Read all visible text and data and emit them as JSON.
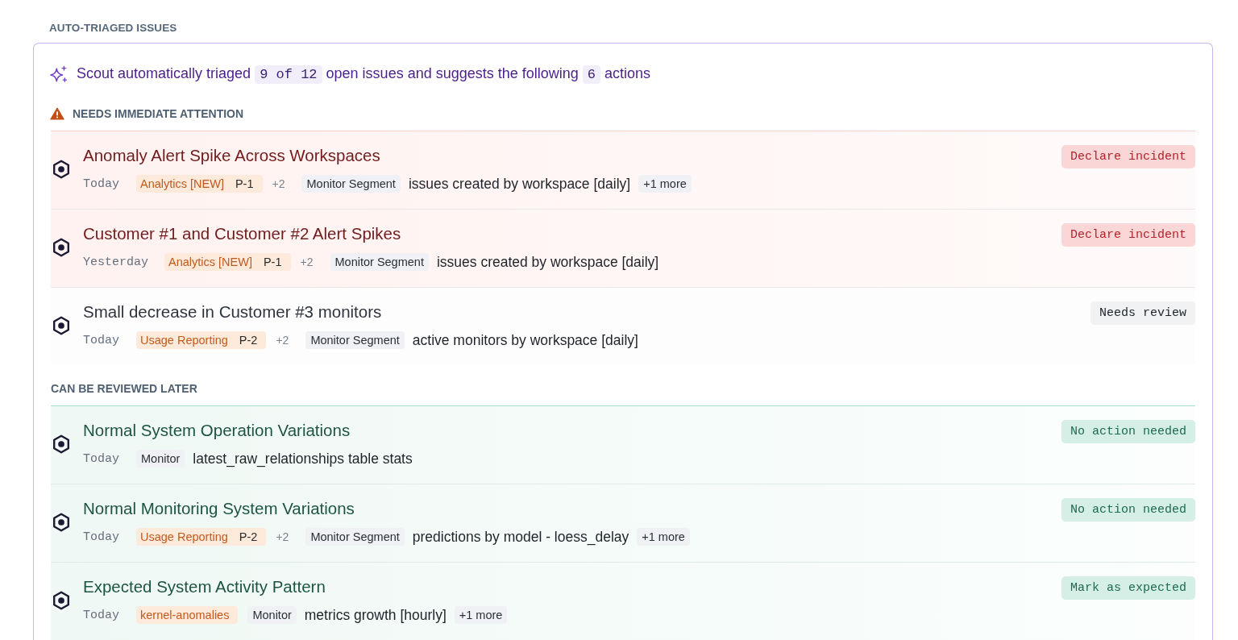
{
  "header": {
    "title": "AUTO-TRIAGED ISSUES"
  },
  "summary": {
    "parts": [
      {
        "kind": "text",
        "text": "Scout automatically triaged"
      },
      {
        "kind": "code",
        "text": "9 of 12"
      },
      {
        "kind": "text",
        "text": "open issues and suggests the following"
      },
      {
        "kind": "code",
        "text": "6"
      },
      {
        "kind": "text",
        "text": "actions"
      }
    ]
  },
  "groups": [
    {
      "kind": "urgent",
      "title": "NEEDS IMMEDIATE ATTENTION",
      "issues": [
        {
          "kind": "incident",
          "title": "Anomaly Alert Spike Across Workspaces",
          "date": "Today",
          "team": {
            "name": "Analytics [NEW]",
            "priority": "P-1"
          },
          "extra": "+2",
          "monitor_type": "Monitor Segment",
          "monitor": "issues created by workspace [daily]",
          "more": "+1 more",
          "action": "Declare incident"
        },
        {
          "kind": "incident",
          "title": "Customer #1 and Customer #2 Alert Spikes",
          "date": "Yesterday",
          "team": {
            "name": "Analytics [NEW]",
            "priority": "P-1"
          },
          "extra": "+2",
          "monitor_type": "Monitor Segment",
          "monitor": "issues created by workspace [daily]",
          "action": "Declare incident"
        },
        {
          "kind": "review",
          "title": "Small decrease in Customer #3 monitors",
          "date": "Today",
          "team": {
            "name": "Usage Reporting",
            "priority": "P-2"
          },
          "extra": "+2",
          "monitor_type": "Monitor Segment",
          "monitor": "active monitors by workspace [daily]",
          "action": "Needs review"
        }
      ]
    },
    {
      "kind": "later",
      "title": "CAN BE REVIEWED LATER",
      "issues": [
        {
          "kind": "ok",
          "title": "Normal System Operation Variations",
          "date": "Today",
          "monitor_type": "Monitor",
          "monitor": "latest_raw_relationships table stats",
          "action": "No action needed"
        },
        {
          "kind": "ok",
          "title": "Normal Monitoring System Variations",
          "date": "Today",
          "team": {
            "name": "Usage Reporting",
            "priority": "P-2"
          },
          "extra": "+2",
          "monitor_type": "Monitor Segment",
          "monitor": "predictions by model - loess_delay",
          "more": "+1 more",
          "action": "No action needed"
        },
        {
          "kind": "ok",
          "title": "Expected System Activity Pattern",
          "date": "Today",
          "team": {
            "name": "kernel-anomalies"
          },
          "monitor_type": "Monitor",
          "monitor": "metrics growth [hourly]",
          "more": "+1 more",
          "action": "Mark as expected"
        }
      ]
    }
  ]
}
